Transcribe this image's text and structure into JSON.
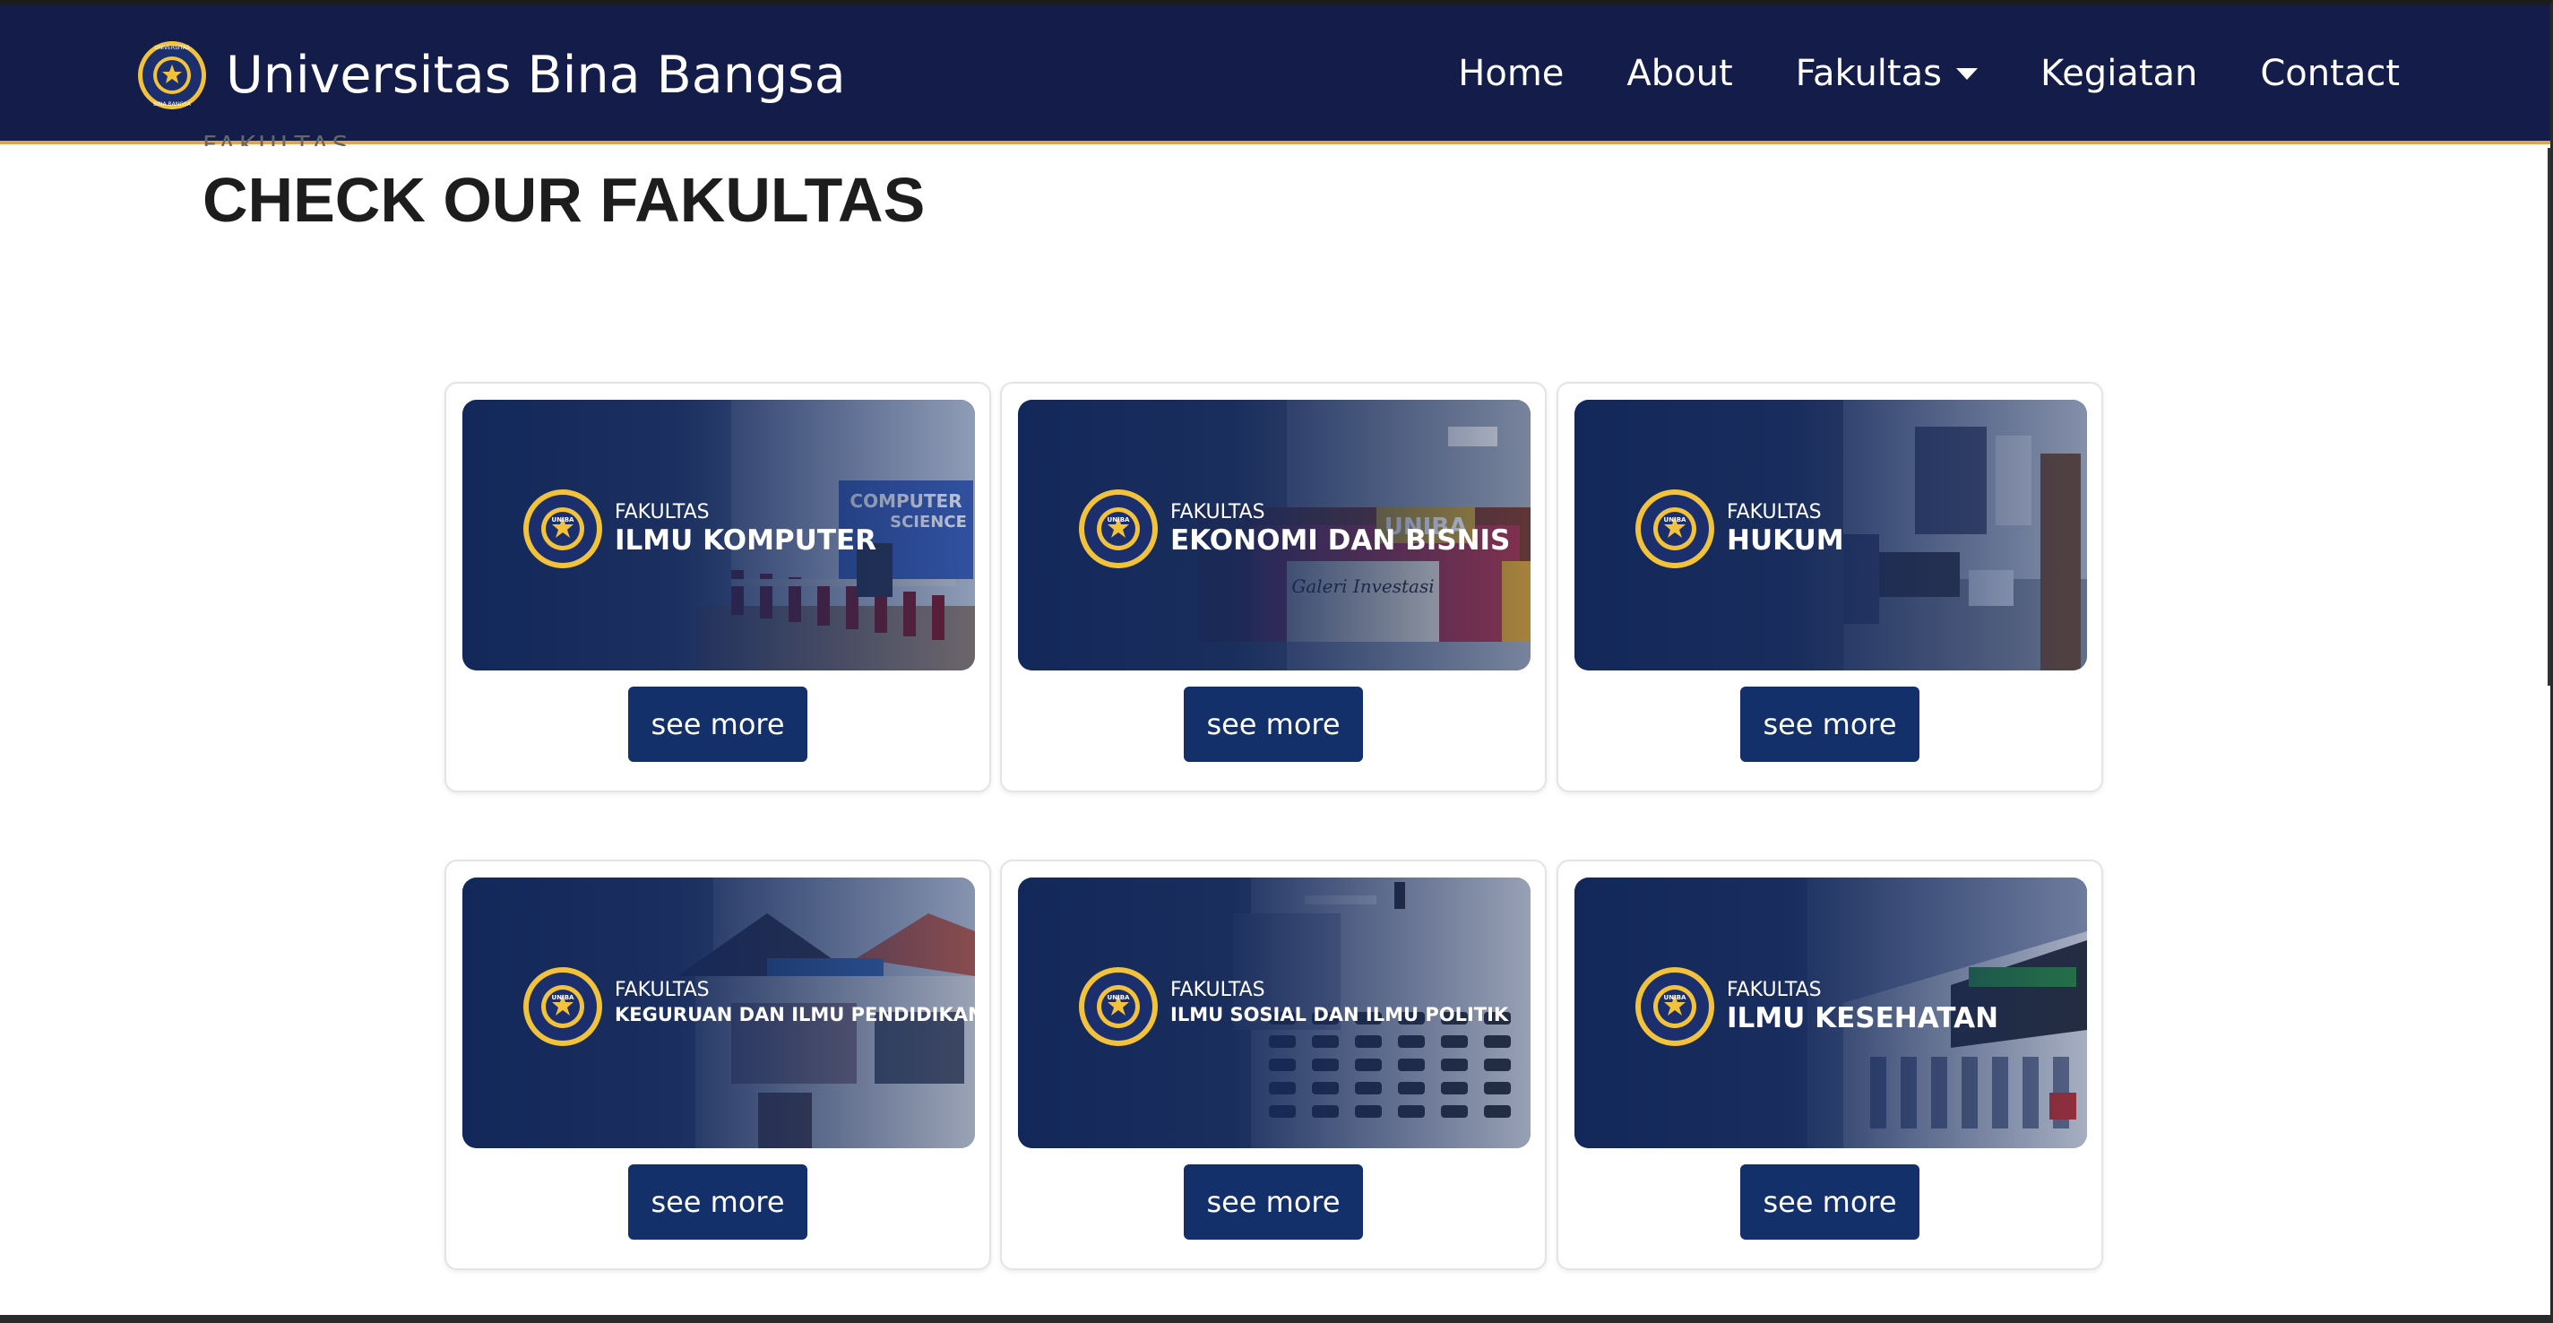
{
  "navbar": {
    "brand_title": "Universitas Bina Bangsa",
    "logo_ring_text_top": "UNIVERSITAS",
    "logo_ring_text_bottom": "BINA BANGSA",
    "logo_center_text": "UNIBA",
    "links": {
      "home": "Home",
      "about": "About",
      "fakultas": "Fakultas",
      "kegiatan": "Kegiatan",
      "contact": "Contact"
    }
  },
  "section": {
    "eyebrow": "FAKULTAS",
    "title": "CHECK OUR FAKULTAS"
  },
  "cards": [
    {
      "prefix": "FAKULTAS",
      "name": "ILMU KOMPUTER",
      "button": "see more",
      "photo_text_1": "COMPUTER",
      "photo_text_2": "SCIENCE"
    },
    {
      "prefix": "FAKULTAS",
      "name": "EKONOMI DAN BISNIS",
      "button": "see more",
      "photo_text_1": "UNIBA",
      "photo_text_2": "Galeri Investasi"
    },
    {
      "prefix": "FAKULTAS",
      "name": "HUKUM",
      "button": "see more"
    },
    {
      "prefix": "FAKULTAS",
      "name": "KEGURUAN DAN ILMU PENDIDIKAN",
      "button": "see more"
    },
    {
      "prefix": "FAKULTAS",
      "name": "ILMU SOSIAL DAN ILMU POLITIK",
      "button": "see more"
    },
    {
      "prefix": "FAKULTAS",
      "name": "ILMU KESEHATAN",
      "button": "see more"
    }
  ],
  "colors": {
    "navbar_bg": "#141c4a",
    "navbar_accent": "#e0a450",
    "button_bg": "#13306b",
    "card_overlay": "#13285a"
  }
}
